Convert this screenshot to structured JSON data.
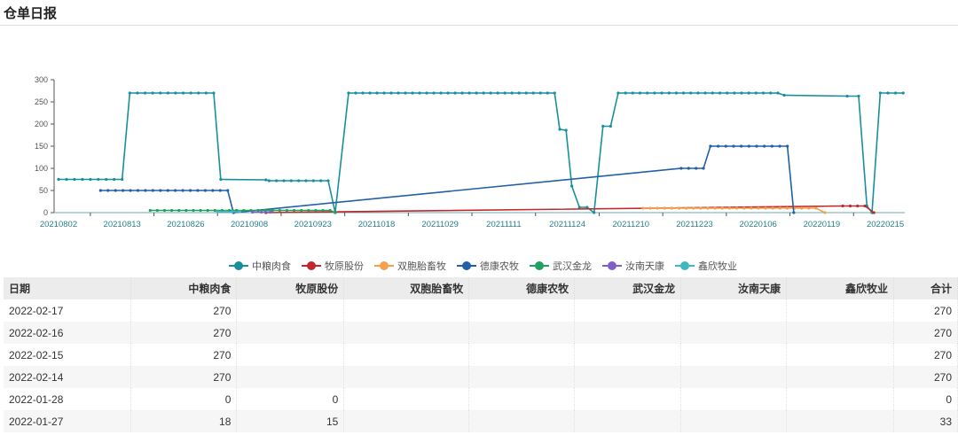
{
  "page_title": "仓单日报",
  "chart_data": {
    "type": "line",
    "title": "",
    "xlabel": "",
    "ylabel": "",
    "x_tick_labels": [
      "20210802",
      "20210813",
      "20210826",
      "20210908",
      "20210923",
      "20211018",
      "20211029",
      "20211111",
      "20211124",
      "20211210",
      "20211223",
      "20220106",
      "20220119",
      "20220215"
    ],
    "x_unit": "tick-label index (0 = 20210802)",
    "xlim": [
      0,
      13.3
    ],
    "y_ticks": [
      0,
      50,
      100,
      150,
      200,
      250,
      300
    ],
    "ylim": [
      0,
      300
    ],
    "grid": false,
    "legend_position": "bottom",
    "series": [
      {
        "name": "中粮肉食",
        "color": "#17909c",
        "points": [
          [
            0,
            75
          ],
          [
            1.0,
            75
          ],
          [
            1.12,
            270
          ],
          [
            2.44,
            270
          ],
          [
            2.55,
            75
          ],
          [
            3.26,
            74
          ],
          [
            3.31,
            72
          ],
          [
            4.24,
            72
          ],
          [
            4.35,
            0
          ],
          [
            4.56,
            270
          ],
          [
            7.8,
            270
          ],
          [
            7.88,
            188
          ],
          [
            7.98,
            186
          ],
          [
            8.07,
            60
          ],
          [
            8.19,
            12
          ],
          [
            8.31,
            12
          ],
          [
            8.42,
            0
          ],
          [
            8.56,
            195
          ],
          [
            8.68,
            195
          ],
          [
            8.8,
            270
          ],
          [
            11.31,
            270
          ],
          [
            11.41,
            265
          ],
          [
            12.4,
            263
          ],
          [
            12.58,
            263
          ],
          [
            12.71,
            15
          ],
          [
            12.79,
            0
          ],
          [
            12.92,
            270
          ],
          [
            13.28,
            270
          ]
        ]
      },
      {
        "name": "牧原股份",
        "color": "#c0282c",
        "points": [
          [
            3.26,
            0
          ],
          [
            12.33,
            15
          ],
          [
            12.68,
            15
          ],
          [
            12.82,
            0
          ]
        ]
      },
      {
        "name": "双胞胎畜牧",
        "color": "#f5a050",
        "points": [
          [
            9.19,
            10
          ],
          [
            11.91,
            10
          ],
          [
            12.05,
            0
          ]
        ]
      },
      {
        "name": "德康农牧",
        "color": "#2160a8",
        "points": [
          [
            0.66,
            50
          ],
          [
            2.66,
            50
          ],
          [
            2.75,
            0
          ],
          [
            9.79,
            100
          ],
          [
            10.14,
            100
          ],
          [
            10.25,
            150
          ],
          [
            11.46,
            150
          ],
          [
            11.56,
            0
          ]
        ]
      },
      {
        "name": "武汉金龙",
        "color": "#22a060",
        "points": [
          [
            1.44,
            5
          ],
          [
            4.27,
            5
          ],
          [
            4.35,
            0
          ]
        ]
      },
      {
        "name": "汝南天康",
        "color": "#8060c8",
        "points": [
          [
            3.05,
            1
          ],
          [
            3.33,
            1
          ]
        ]
      },
      {
        "name": "鑫欣牧业",
        "color": "#40b8c0",
        "points": [
          [
            2.5,
            2
          ],
          [
            2.85,
            2
          ]
        ]
      }
    ]
  },
  "table": {
    "headers": [
      "日期",
      "中粮肉食",
      "牧原股份",
      "双胞胎畜牧",
      "德康农牧",
      "武汉金龙",
      "汝南天康",
      "鑫欣牧业",
      "合计"
    ],
    "rows": [
      [
        "2022-02-17",
        "270",
        "",
        "",
        "",
        "",
        "",
        "",
        "270"
      ],
      [
        "2022-02-16",
        "270",
        "",
        "",
        "",
        "",
        "",
        "",
        "270"
      ],
      [
        "2022-02-15",
        "270",
        "",
        "",
        "",
        "",
        "",
        "",
        "270"
      ],
      [
        "2022-02-14",
        "270",
        "",
        "",
        "",
        "",
        "",
        "",
        "270"
      ],
      [
        "2022-01-28",
        "0",
        "0",
        "",
        "",
        "",
        "",
        "",
        "0"
      ],
      [
        "2022-01-27",
        "18",
        "15",
        "",
        "",
        "",
        "",
        "",
        "33"
      ]
    ]
  }
}
